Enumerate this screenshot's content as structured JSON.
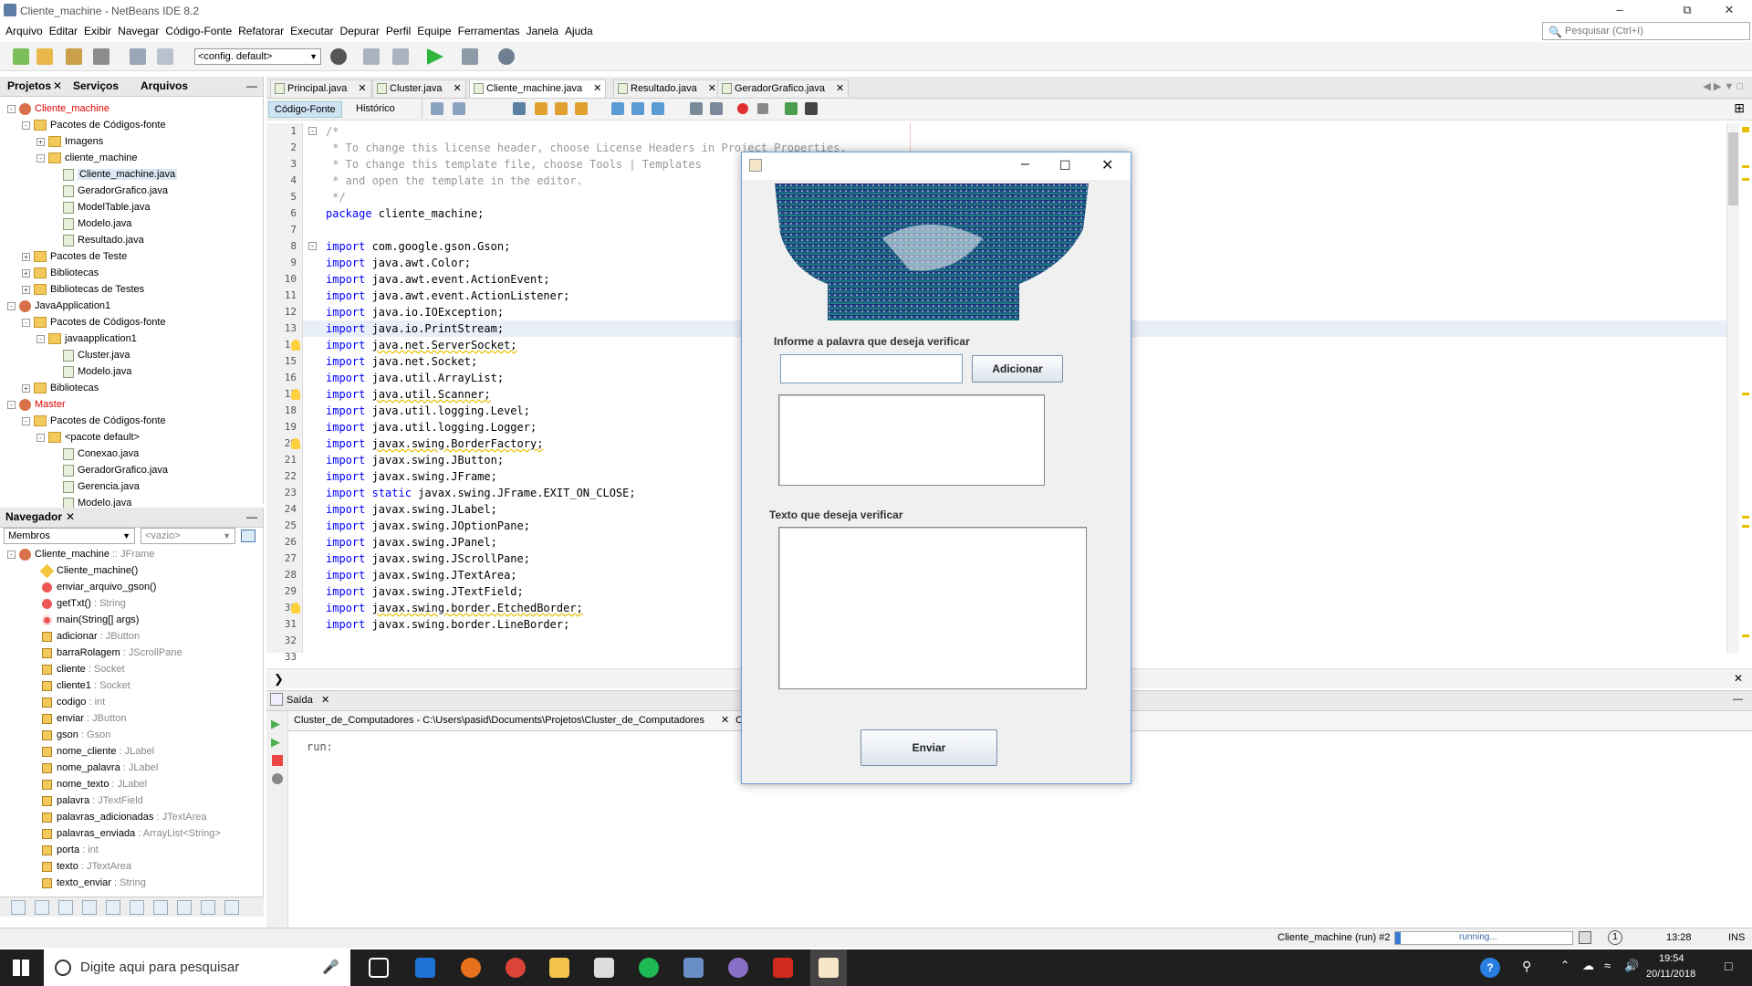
{
  "window": {
    "title": "Cliente_machine - NetBeans IDE 8.2",
    "search_placeholder": "Pesquisar (Ctrl+I)"
  },
  "menu": [
    "Arquivo",
    "Editar",
    "Exibir",
    "Navegar",
    "Código-Fonte",
    "Refatorar",
    "Executar",
    "Depurar",
    "Perfil",
    "Equipe",
    "Ferramentas",
    "Janela",
    "Ajuda"
  ],
  "toolbar": {
    "config": "<config. default>"
  },
  "project_panel": {
    "tabs": [
      "Projetos",
      "Serviços",
      "Arquivos"
    ],
    "tree": [
      {
        "label": "Cliente_machine",
        "type": "project",
        "red": true,
        "indent": 0,
        "toggle": "-"
      },
      {
        "label": "Pacotes de Códigos-fonte",
        "type": "pkg",
        "indent": 1,
        "toggle": "-"
      },
      {
        "label": "Imagens",
        "type": "pkg",
        "indent": 2,
        "toggle": "+"
      },
      {
        "label": "cliente_machine",
        "type": "pkg",
        "indent": 2,
        "toggle": "-"
      },
      {
        "label": "Cliente_machine.java",
        "type": "java",
        "indent": 3,
        "selected": true
      },
      {
        "label": "GeradorGrafico.java",
        "type": "java",
        "indent": 3
      },
      {
        "label": "ModelTable.java",
        "type": "java",
        "indent": 3
      },
      {
        "label": "Modelo.java",
        "type": "java",
        "indent": 3
      },
      {
        "label": "Resultado.java",
        "type": "java",
        "indent": 3
      },
      {
        "label": "Pacotes de Teste",
        "type": "pkg",
        "indent": 1,
        "toggle": "+"
      },
      {
        "label": "Bibliotecas",
        "type": "pkg",
        "indent": 1,
        "toggle": "+"
      },
      {
        "label": "Bibliotecas de Testes",
        "type": "pkg",
        "indent": 1,
        "toggle": "+"
      },
      {
        "label": "JavaApplication1",
        "type": "project",
        "indent": 0,
        "toggle": "-"
      },
      {
        "label": "Pacotes de Códigos-fonte",
        "type": "pkg",
        "indent": 1,
        "toggle": "-"
      },
      {
        "label": "javaapplication1",
        "type": "pkg",
        "indent": 2,
        "toggle": "-"
      },
      {
        "label": "Cluster.java",
        "type": "java",
        "indent": 3
      },
      {
        "label": "Modelo.java",
        "type": "java",
        "indent": 3
      },
      {
        "label": "Bibliotecas",
        "type": "pkg",
        "indent": 1,
        "toggle": "+"
      },
      {
        "label": "Master",
        "type": "project",
        "red": true,
        "indent": 0,
        "toggle": "-"
      },
      {
        "label": "Pacotes de Códigos-fonte",
        "type": "pkg",
        "indent": 1,
        "toggle": "-"
      },
      {
        "label": "<pacote default>",
        "type": "pkg",
        "indent": 2,
        "toggle": "-"
      },
      {
        "label": "Conexao.java",
        "type": "java",
        "indent": 3
      },
      {
        "label": "GeradorGrafico.java",
        "type": "java",
        "indent": 3
      },
      {
        "label": "Gerencia.java",
        "type": "java",
        "indent": 3
      },
      {
        "label": "Modelo.java",
        "type": "java",
        "indent": 3
      }
    ]
  },
  "navigator": {
    "title": "Navegador",
    "filter": "Membros",
    "filter2": "<vazio>",
    "root": "Cliente_machine",
    "root_type": ":: JFrame",
    "members": [
      {
        "name": "Cliente_machine()",
        "type": "",
        "icon": "ctor"
      },
      {
        "name": "enviar_arquivo_gson()",
        "type": "",
        "icon": "method"
      },
      {
        "name": "getTxt()",
        "type": " : String",
        "icon": "method"
      },
      {
        "name": "main(String[] args)",
        "type": "",
        "icon": "static"
      },
      {
        "name": "adicionar",
        "type": " : JButton",
        "icon": "field"
      },
      {
        "name": "barraRolagem",
        "type": " : JScrollPane",
        "icon": "field"
      },
      {
        "name": "cliente",
        "type": " : Socket",
        "icon": "field"
      },
      {
        "name": "cliente1",
        "type": " : Socket",
        "icon": "field"
      },
      {
        "name": "codigo",
        "type": " : int",
        "icon": "field"
      },
      {
        "name": "enviar",
        "type": " : JButton",
        "icon": "field"
      },
      {
        "name": "gson",
        "type": " : Gson",
        "icon": "field"
      },
      {
        "name": "nome_cliente",
        "type": " : JLabel",
        "icon": "field"
      },
      {
        "name": "nome_palavra",
        "type": " : JLabel",
        "icon": "field"
      },
      {
        "name": "nome_texto",
        "type": " : JLabel",
        "icon": "field"
      },
      {
        "name": "palavra",
        "type": " : JTextField",
        "icon": "field"
      },
      {
        "name": "palavras_adicionadas",
        "type": " : JTextArea",
        "icon": "field"
      },
      {
        "name": "palavras_enviada",
        "type": " : ArrayList<String>",
        "icon": "field"
      },
      {
        "name": "porta",
        "type": " : int",
        "icon": "field"
      },
      {
        "name": "texto",
        "type": " : JTextArea",
        "icon": "field"
      },
      {
        "name": "texto_enviar",
        "type": " : String",
        "icon": "field"
      }
    ]
  },
  "editor": {
    "tabs": [
      "Principal.java",
      "Cluster.java",
      "Cliente_machine.java",
      "Resultado.java",
      "GeradorGrafico.java"
    ],
    "active_tab": 2,
    "view_tabs": [
      "Código-Fonte",
      "Histórico"
    ],
    "lines": [
      {
        "n": 1,
        "html": "<span class=\"cm\">/*</span>"
      },
      {
        "n": 2,
        "html": "<span class=\"cm\"> * To change this license header, choose License Headers in Project Properties.</span>"
      },
      {
        "n": 3,
        "html": "<span class=\"cm\"> * To change this template file, choose Tools | Templates</span>"
      },
      {
        "n": 4,
        "html": "<span class=\"cm\"> * and open the template in the editor.</span>"
      },
      {
        "n": 5,
        "html": "<span class=\"cm\"> */</span>"
      },
      {
        "n": 6,
        "html": "<span class=\"kw\">package</span> cliente_machine;"
      },
      {
        "n": 7,
        "html": ""
      },
      {
        "n": 8,
        "html": "<span class=\"kw\">import</span> com.google.gson.Gson;"
      },
      {
        "n": 9,
        "html": "<span class=\"kw\">import</span> java.awt.Color;"
      },
      {
        "n": 10,
        "html": "<span class=\"kw\">import</span> java.awt.event.ActionEvent;"
      },
      {
        "n": 11,
        "html": "<span class=\"kw\">import</span> java.awt.event.ActionListener;"
      },
      {
        "n": 12,
        "html": "<span class=\"kw\">import</span> java.io.IOException;"
      },
      {
        "n": 13,
        "html": "<span class=\"kw\">import</span> java.io.PrintStream;",
        "hl": true
      },
      {
        "n": 14,
        "html": "<span class=\"kw\">import</span> <span class=\"warn\">java.net.ServerSocket;</span>",
        "warn": true
      },
      {
        "n": 15,
        "html": "<span class=\"kw\">import</span> java.net.Socket;"
      },
      {
        "n": 16,
        "html": "<span class=\"kw\">import</span> java.util.ArrayList;"
      },
      {
        "n": 17,
        "html": "<span class=\"kw\">import</span> <span class=\"warn\">java.util.Scanner;</span>",
        "warn": true
      },
      {
        "n": 18,
        "html": "<span class=\"kw\">import</span> java.util.logging.Level;"
      },
      {
        "n": 19,
        "html": "<span class=\"kw\">import</span> java.util.logging.Logger;"
      },
      {
        "n": 20,
        "html": "<span class=\"kw\">import</span> <span class=\"warn\">javax.swing.BorderFactory;</span>",
        "warn": true
      },
      {
        "n": 21,
        "html": "<span class=\"kw\">import</span> javax.swing.JButton;"
      },
      {
        "n": 22,
        "html": "<span class=\"kw\">import</span> javax.swing.JFrame;"
      },
      {
        "n": 23,
        "html": "<span class=\"kw\">import</span> <span class=\"kw\">static</span> javax.swing.JFrame.EXIT_ON_CLOSE;"
      },
      {
        "n": 24,
        "html": "<span class=\"kw\">import</span> javax.swing.JLabel;"
      },
      {
        "n": 25,
        "html": "<span class=\"kw\">import</span> javax.swing.JOptionPane;"
      },
      {
        "n": 26,
        "html": "<span class=\"kw\">import</span> javax.swing.JPanel;"
      },
      {
        "n": 27,
        "html": "<span class=\"kw\">import</span> javax.swing.JScrollPane;"
      },
      {
        "n": 28,
        "html": "<span class=\"kw\">import</span> javax.swing.JTextArea;"
      },
      {
        "n": 29,
        "html": "<span class=\"kw\">import</span> javax.swing.JTextField;"
      },
      {
        "n": 30,
        "html": "<span class=\"kw\">import</span> <span class=\"warn\">javax.swing.border.EtchedBorder;</span>",
        "warn": true
      },
      {
        "n": 31,
        "html": "<span class=\"kw\">import</span> javax.swing.border.LineBorder;"
      },
      {
        "n": 32,
        "html": ""
      },
      {
        "n": 33,
        "html": ""
      }
    ]
  },
  "output": {
    "tab": "Saída",
    "subtab": "Cluster_de_Computadores - C:\\Users\\pasid\\Documents\\Projetos\\Cluster_de_Computadores",
    "subtab2": "Clie",
    "text": "run:"
  },
  "status": {
    "task": "Cliente_machine (run) #2",
    "progress": "running...",
    "position": "13:28",
    "mode": "INS"
  },
  "dialog": {
    "label_word": "Informe a palavra que deseja verificar",
    "word_value": "",
    "add_button": "Adicionar",
    "label_text": "Texto que deseja verificar",
    "send_button": "Enviar"
  },
  "taskbar": {
    "search_placeholder": "Digite aqui para pesquisar",
    "time": "19:54",
    "date": "20/11/2018"
  }
}
